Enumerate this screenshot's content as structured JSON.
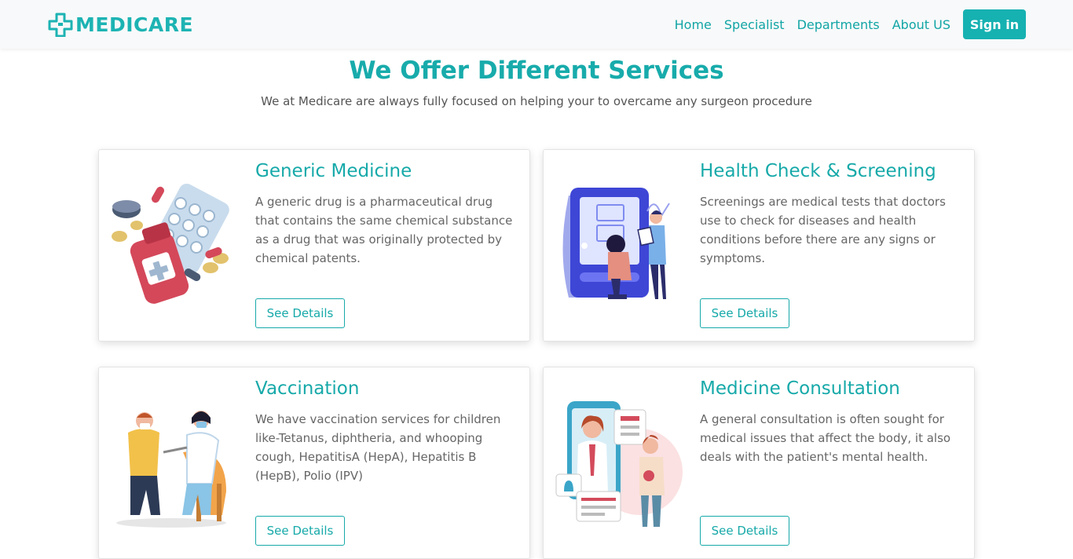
{
  "navbar": {
    "brand": "MEDICARE",
    "links": [
      "Home",
      "Specialist",
      "Departments",
      "About US"
    ],
    "signin": "Sign in"
  },
  "hero": {
    "title": "We Offer Different Services",
    "subtitle": "We at Medicare are always fully focused on helping your to overcame any surgeon procedure"
  },
  "services": [
    {
      "title": "Generic Medicine",
      "description": "A generic drug is a pharmaceutical drug that contains the same chemical substance as a drug that was originally protected by chemical patents.",
      "button": "See Details",
      "image": "pills-bottle-illustration"
    },
    {
      "title": "Health Check & Screening",
      "description": "Screenings are medical tests that doctors use to check for diseases and health conditions before there are any signs or symptoms.",
      "button": "See Details",
      "image": "blood-pressure-monitor-illustration"
    },
    {
      "title": "Vaccination",
      "description": "We have vaccination services for children like-Tetanus, diphtheria, and whooping cough, HepatitisA (HepA), Hepatitis B (HepB), Polio (IPV)",
      "button": "See Details",
      "image": "vaccination-illustration"
    },
    {
      "title": "Medicine Consultation",
      "description": "A general consultation is often sought for medical issues that affect the body, it also deals with the patient's mental health.",
      "button": "See Details",
      "image": "online-consultation-illustration"
    }
  ],
  "colors": {
    "accent": "#17a9a9",
    "navbar_bg": "#f8f9fa",
    "text": "#666666"
  }
}
